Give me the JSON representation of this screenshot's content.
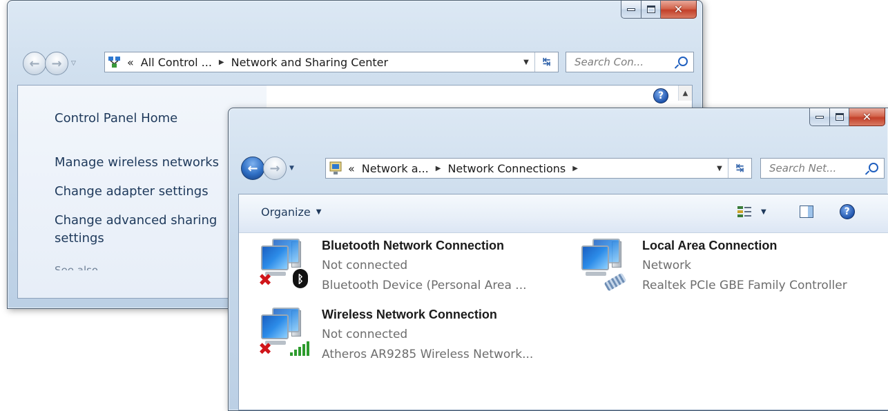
{
  "back_window": {
    "address": {
      "chevron": "«",
      "crumb1": "All Control ...",
      "crumb2": "Network and Sharing Center"
    },
    "search_placeholder": "Search Con...",
    "tasks": {
      "home": "Control Panel Home",
      "wireless": "Manage wireless networks",
      "adapter": "Change adapter settings",
      "sharing_line1": "Change advanced sharing",
      "sharing_line2": "settings",
      "see_also": "See also"
    },
    "help_label": "?"
  },
  "front_window": {
    "address": {
      "chevron": "«",
      "crumb1": "Network a...",
      "crumb2": "Network Connections"
    },
    "search_placeholder": "Search Net...",
    "toolbar": {
      "organize": "Organize",
      "help_label": "?"
    },
    "connections": [
      {
        "name": "Bluetooth Network Connection",
        "status": "Not connected",
        "device": "Bluetooth Device (Personal Area ...",
        "badge": "bluetooth-icon",
        "disconnected": true
      },
      {
        "name": "Local Area Connection",
        "status": "Network",
        "device": "Realtek PCIe GBE Family Controller",
        "badge": "ethernet-cable-icon",
        "disconnected": false
      },
      {
        "name": "Wireless Network Connection",
        "status": "Not connected",
        "device": "Atheros AR9285 Wireless Network...",
        "badge": "signal-bars-icon",
        "disconnected": true
      }
    ]
  },
  "colors": {
    "accent": "#1e395b",
    "close_button": "#c3402a",
    "error_x": "#d0151a",
    "signal_green": "#2d9b2d"
  }
}
